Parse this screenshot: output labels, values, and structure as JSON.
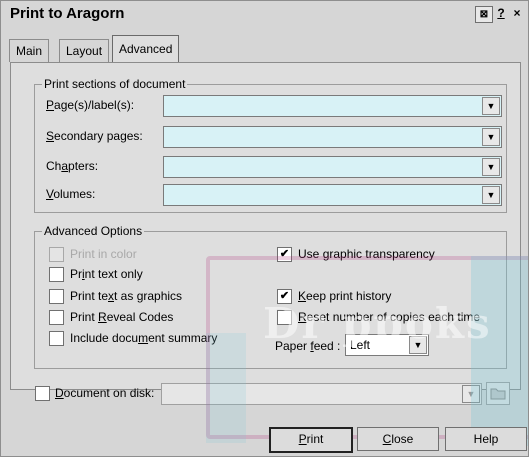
{
  "window": {
    "title": "Print to Aragorn",
    "help_btn": "?",
    "close_btn": "×",
    "extra_btn": "⊠"
  },
  "tabs": [
    {
      "label": "Main"
    },
    {
      "label": "Layout"
    },
    {
      "label": "Advanced",
      "active": true
    }
  ],
  "print_sections": {
    "legend": "Print sections of document",
    "fields": [
      {
        "pre": "",
        "key": "P",
        "post": "age(s)/label(s):",
        "value": ""
      },
      {
        "pre": "",
        "key": "S",
        "post": "econdary pages:",
        "value": ""
      },
      {
        "pre": "Ch",
        "key": "a",
        "post": "pters:",
        "value": ""
      },
      {
        "pre": "",
        "key": "V",
        "post": "olumes:",
        "value": ""
      }
    ]
  },
  "advanced": {
    "legend": "Advanced Options",
    "print_in_color": {
      "label": "Print in color",
      "checked": false,
      "disabled": true
    },
    "print_text_only": {
      "pre": "Pr",
      "key": "i",
      "post": "nt text only",
      "checked": false
    },
    "print_text_as_graphics": {
      "pre": "Print te",
      "key": "x",
      "post": "t as graphics",
      "checked": false
    },
    "print_reveal_codes": {
      "pre": "Print ",
      "key": "R",
      "post": "eveal Codes",
      "checked": false
    },
    "include_summary": {
      "pre": "Include docu",
      "key": "m",
      "post": "ent summary",
      "checked": false
    },
    "use_graphic_transparency": {
      "pre": "Use ",
      "key": "g",
      "post": "raphic transparency",
      "checked": true
    },
    "keep_print_history": {
      "pre": "",
      "key": "K",
      "post": "eep print history",
      "checked": true
    },
    "reset_copies": {
      "pre": "",
      "key": "R",
      "post": "eset number of copies each time",
      "checked": false
    },
    "paper_feed": {
      "pre": "Paper ",
      "key": "f",
      "post": "eed :",
      "value": "Left"
    }
  },
  "disk": {
    "pre": "",
    "key": "D",
    "post": "ocument on disk:",
    "checked": false,
    "value": ""
  },
  "buttons": {
    "print": {
      "key": "P",
      "post": "rint"
    },
    "close": {
      "key": "C",
      "post": "lose"
    },
    "help": {
      "label": "Help"
    }
  },
  "watermark": {
    "text": "Dr  ppoks"
  },
  "colors": {
    "field_bg": "#d8f2f6",
    "dialog_bg": "#d6d6d6",
    "panel_bg": "#dedede",
    "watermark_frame": "#af2878",
    "watermark_fill": "#78c8d7"
  }
}
